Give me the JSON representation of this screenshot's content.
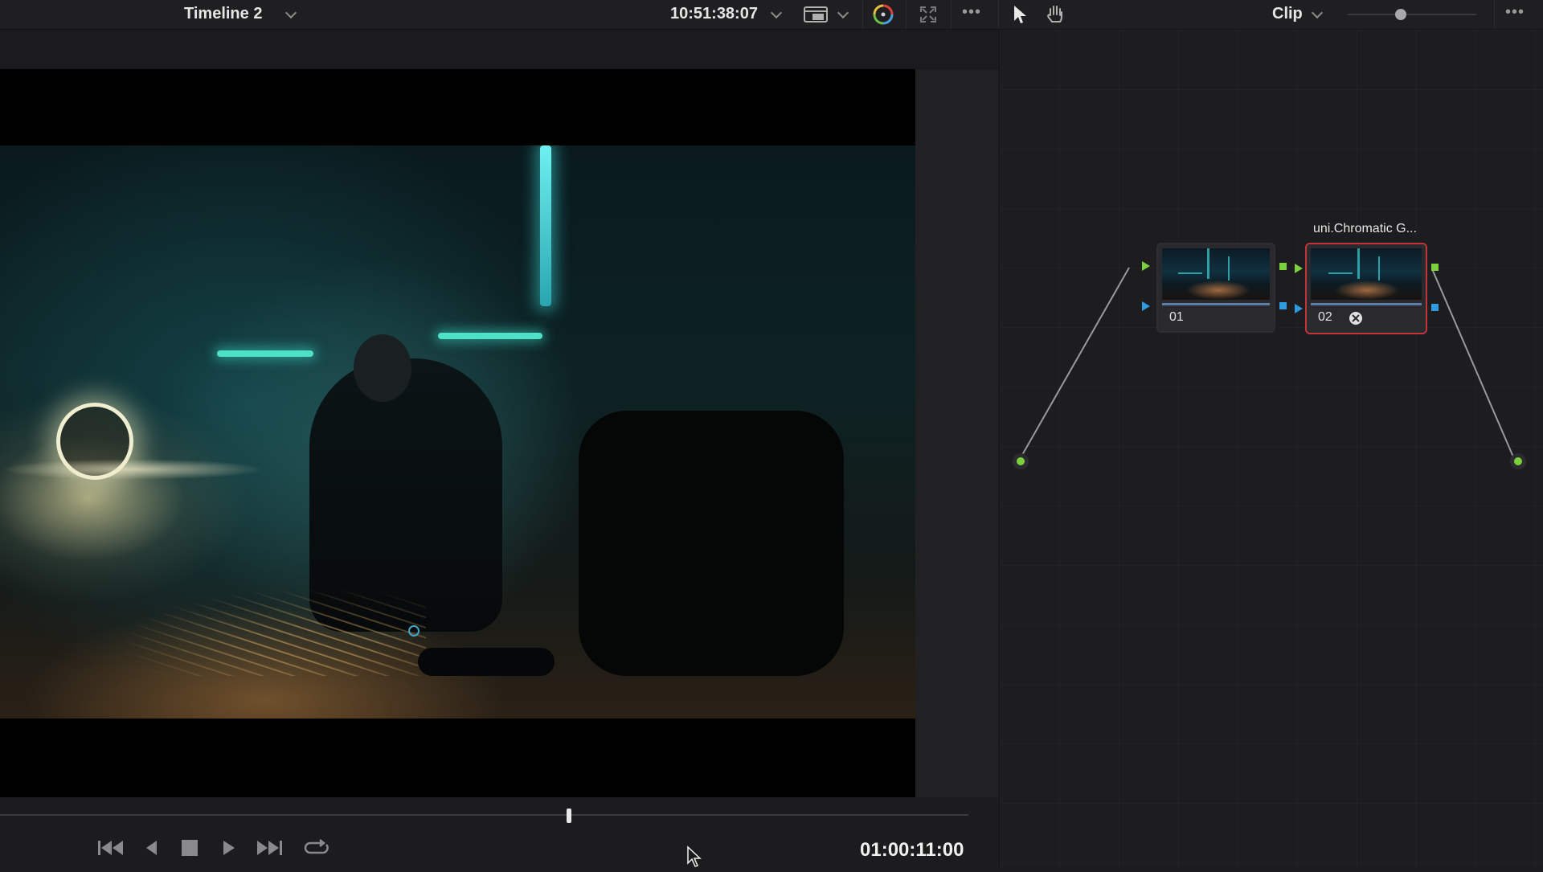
{
  "topbar": {
    "timeline_name": "Timeline 2",
    "timecode": "10:51:38:07",
    "mode_label": "Clip"
  },
  "transport": {
    "timecode": "01:00:11:00"
  },
  "nodes": [
    {
      "number": "01",
      "title": ""
    },
    {
      "number": "02",
      "title": "uni.Chromatic G..."
    }
  ],
  "icons": [
    "chevron-down-icon",
    "hq-display-icon",
    "color-wheel-icon",
    "fullscreen-icon",
    "more-icon",
    "pointer-tool-icon",
    "hand-tool-icon",
    "skip-back-icon",
    "step-back-icon",
    "stop-icon",
    "play-icon",
    "skip-forward-icon",
    "loop-icon",
    "fx-icon"
  ],
  "colors": {
    "node_selected_border": "#c0353a",
    "port_green": "#7bd13c",
    "port_blue": "#2f9be0"
  }
}
